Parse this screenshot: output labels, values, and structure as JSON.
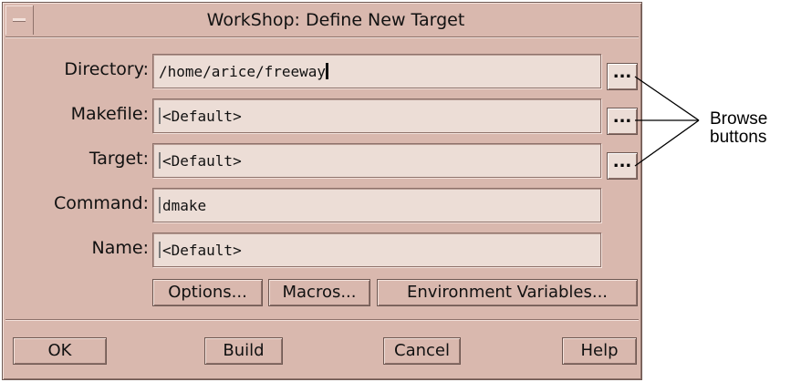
{
  "window": {
    "title": "WorkShop: Define New Target"
  },
  "fields": [
    {
      "label": "Directory:",
      "value": "/home/arice/freeway",
      "has_browse": true
    },
    {
      "label": "Makefile:",
      "value": "<Default>",
      "has_browse": true
    },
    {
      "label": "Target:",
      "value": "<Default>",
      "has_browse": true
    },
    {
      "label": "Command:",
      "value": "dmake",
      "has_browse": false
    },
    {
      "label": "Name:",
      "value": "<Default>",
      "has_browse": false
    }
  ],
  "browse_label": "...",
  "option_buttons": {
    "options": "Options...",
    "macros": "Macros...",
    "env": "Environment Variables..."
  },
  "footer_buttons": {
    "ok": "OK",
    "build": "Build",
    "cancel": "Cancel",
    "help": "Help"
  },
  "callout": {
    "line1": "Browse",
    "line2": "buttons"
  },
  "colors": {
    "dialog_bg": "#d9b8ae",
    "field_bg": "#ecddd6"
  }
}
